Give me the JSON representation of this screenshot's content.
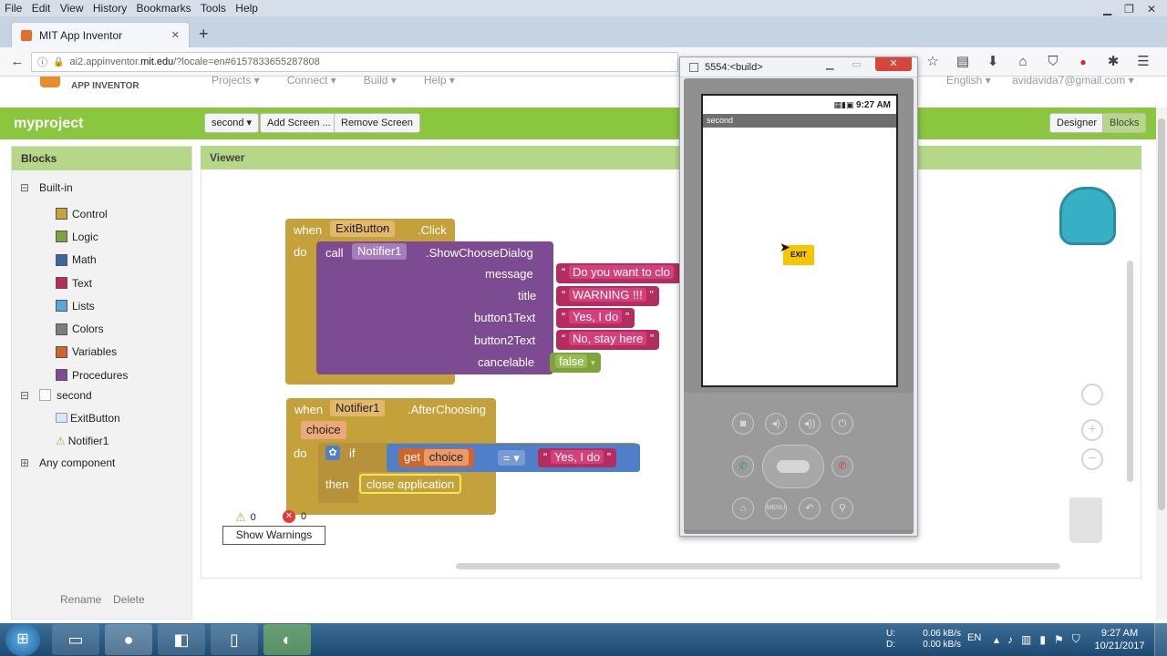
{
  "browser": {
    "menu": [
      "File",
      "Edit",
      "View",
      "History",
      "Bookmarks",
      "Tools",
      "Help"
    ],
    "tab_title": "MIT App Inventor",
    "url_prefix": "ai2.appinventor.",
    "url_domain": "mit.edu",
    "url_suffix": "/?locale=en#6157833655287808"
  },
  "app": {
    "logo": "APP INVENTOR",
    "top_menu": [
      "Projects ▾",
      "Connect ▾",
      "Build ▾",
      "Help ▾"
    ],
    "language": "English ▾",
    "user": "avidavida7@gmail.com ▾",
    "project": "myproject",
    "screen_select": "second ▾",
    "add_screen": "Add Screen ...",
    "remove_screen": "Remove Screen",
    "designer": "Designer",
    "blocks_tab": "Blocks"
  },
  "blocks_panel": {
    "title": "Blocks",
    "builtin": "Built-in",
    "items": [
      {
        "label": "Control",
        "color": "#c8a33a"
      },
      {
        "label": "Logic",
        "color": "#7ea33a"
      },
      {
        "label": "Math",
        "color": "#3a66a3"
      },
      {
        "label": "Text",
        "color": "#b32d5e"
      },
      {
        "label": "Lists",
        "color": "#5ba5d8"
      },
      {
        "label": "Colors",
        "color": "#7d7d7d"
      },
      {
        "label": "Variables",
        "color": "#d0652a"
      },
      {
        "label": "Procedures",
        "color": "#7d4b99"
      }
    ],
    "screen": "second",
    "components": [
      "ExitButton",
      "Notifier1"
    ],
    "any_component": "Any component",
    "rename": "Rename",
    "delete": "Delete"
  },
  "viewer": {
    "title": "Viewer",
    "block1": {
      "when": "when",
      "component": "ExitButton",
      "event": ".Click",
      "do": "do",
      "call": "call",
      "notifier": "Notifier1",
      "method": ".ShowChooseDialog",
      "params": [
        {
          "name": "message",
          "value": "Do you want to clo"
        },
        {
          "name": "title",
          "value": "WARNING !!!"
        },
        {
          "name": "button1Text",
          "value": "Yes, I do"
        },
        {
          "name": "button2Text",
          "value": "No, stay here"
        },
        {
          "name": "cancelable",
          "value": "false"
        }
      ]
    },
    "block2": {
      "when": "when",
      "component": "Notifier1",
      "event": ".AfterChoosing",
      "param": "choice",
      "do": "do",
      "if": "if",
      "get": "get",
      "var": "choice",
      "op": "=",
      "compare": "Yes, I do",
      "then": "then",
      "action": "close application"
    },
    "warnings_count": "0",
    "errors_count": "0",
    "show_warnings": "Show Warnings"
  },
  "emulator": {
    "title": "5554:<build>",
    "time": "9:27 AM",
    "screen_title": "second",
    "exit_button": "EXIT",
    "menu_key": "MENU"
  },
  "taskbar": {
    "net_up_label": "U:",
    "net_down_label": "D:",
    "net_up": "0.06 kB/s",
    "net_down": "0.00 kB/s",
    "lang": "EN",
    "time": "9:27 AM",
    "date": "10/21/2017"
  }
}
